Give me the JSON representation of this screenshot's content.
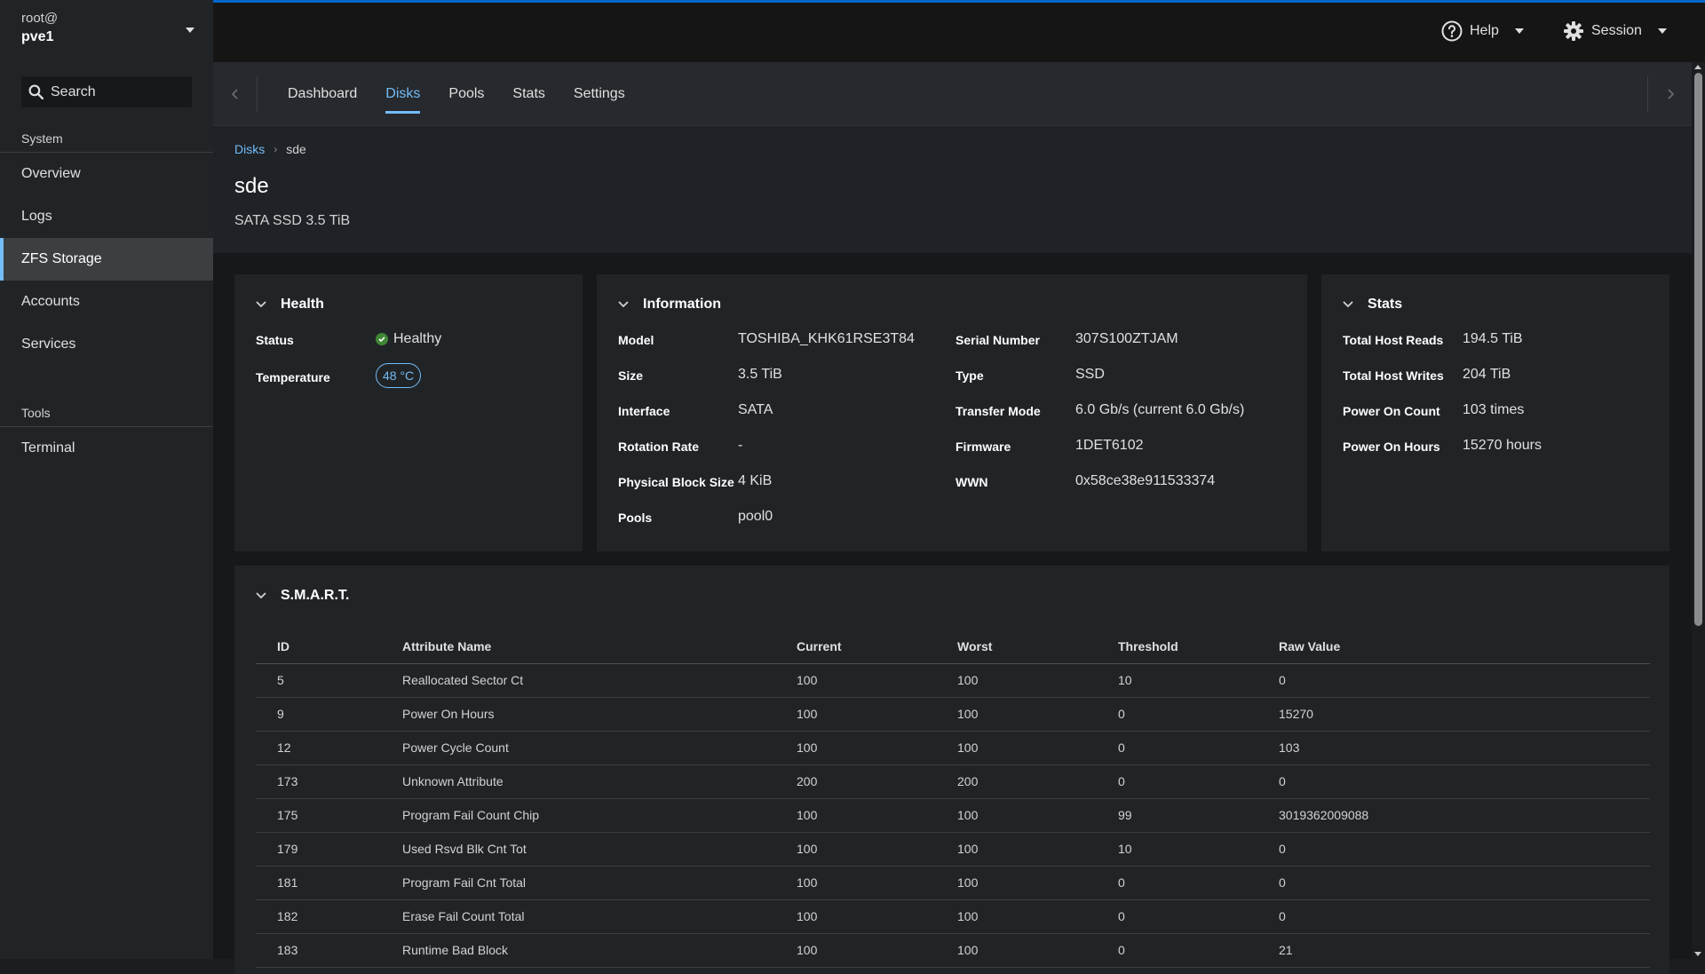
{
  "sidebar": {
    "host": {
      "user": "root@",
      "name": "pve1"
    },
    "search_label": "Search",
    "groups": [
      {
        "title": "System",
        "items": [
          "Overview",
          "Logs",
          "ZFS Storage",
          "Accounts",
          "Services"
        ]
      },
      {
        "title": "Tools",
        "items": [
          "Terminal"
        ]
      }
    ],
    "active_item": "ZFS Storage"
  },
  "topbar": {
    "help_label": "Help",
    "session_label": "Session"
  },
  "tabs": {
    "items": [
      "Dashboard",
      "Disks",
      "Pools",
      "Stats",
      "Settings"
    ],
    "active": "Disks"
  },
  "breadcrumb": {
    "parent": "Disks",
    "current": "sde"
  },
  "page": {
    "title": "sde",
    "subtitle": "SATA SSD 3.5 TiB"
  },
  "health": {
    "title": "Health",
    "status_label": "Status",
    "status_value": "Healthy",
    "status_color": "#3e8635",
    "temperature_label": "Temperature",
    "temperature_value": "48 °C"
  },
  "information": {
    "title": "Information",
    "left": [
      {
        "label": "Model",
        "value": "TOSHIBA_KHK61RSE3T84"
      },
      {
        "label": "Size",
        "value": "3.5 TiB"
      },
      {
        "label": "Interface",
        "value": "SATA"
      },
      {
        "label": "Rotation Rate",
        "value": "-"
      },
      {
        "label": "Physical Block Size",
        "value": "4 KiB"
      },
      {
        "label": "Pools",
        "value": "pool0"
      }
    ],
    "right": [
      {
        "label": "Serial Number",
        "value": "307S100ZTJAM"
      },
      {
        "label": "Type",
        "value": "SSD"
      },
      {
        "label": "Transfer Mode",
        "value": "6.0 Gb/s (current 6.0 Gb/s)"
      },
      {
        "label": "Firmware",
        "value": "1DET6102"
      },
      {
        "label": "WWN",
        "value": "0x58ce38e911533374"
      }
    ]
  },
  "stats": {
    "title": "Stats",
    "rows": [
      {
        "label": "Total Host Reads",
        "value": "194.5 TiB"
      },
      {
        "label": "Total Host Writes",
        "value": "204 TiB"
      },
      {
        "label": "Power On Count",
        "value": "103 times"
      },
      {
        "label": "Power On Hours",
        "value": "15270 hours"
      }
    ]
  },
  "smart": {
    "title": "S.M.A.R.T.",
    "columns": [
      "ID",
      "Attribute Name",
      "Current",
      "Worst",
      "Threshold",
      "Raw Value"
    ],
    "rows": [
      [
        "5",
        "Reallocated Sector Ct",
        "100",
        "100",
        "10",
        "0"
      ],
      [
        "9",
        "Power On Hours",
        "100",
        "100",
        "0",
        "15270"
      ],
      [
        "12",
        "Power Cycle Count",
        "100",
        "100",
        "0",
        "103"
      ],
      [
        "173",
        "Unknown Attribute",
        "200",
        "200",
        "0",
        "0"
      ],
      [
        "175",
        "Program Fail Count Chip",
        "100",
        "100",
        "99",
        "3019362009088"
      ],
      [
        "179",
        "Used Rsvd Blk Cnt Tot",
        "100",
        "100",
        "10",
        "0"
      ],
      [
        "181",
        "Program Fail Cnt Total",
        "100",
        "100",
        "0",
        "0"
      ],
      [
        "182",
        "Erase Fail Count Total",
        "100",
        "100",
        "0",
        "0"
      ],
      [
        "183",
        "Runtime Bad Block",
        "100",
        "100",
        "0",
        "21"
      ]
    ]
  },
  "colors": {
    "accent": "#73bcf7",
    "topbar_accent": "#0066cc",
    "success": "#3e8635"
  },
  "icons": {
    "search": "search-icon",
    "help": "help-circle-icon",
    "session": "gear-icon",
    "expand": "chevron-down-icon"
  }
}
